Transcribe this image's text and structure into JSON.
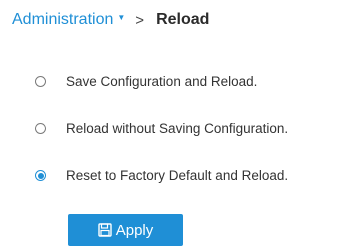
{
  "breadcrumb": {
    "parent": "Administration",
    "caret_icon": "caret-down-icon",
    "separator": ">",
    "current": "Reload"
  },
  "options": [
    {
      "label": "Save Configuration and Reload.",
      "selected": false
    },
    {
      "label": "Reload without Saving Configuration.",
      "selected": false
    },
    {
      "label": "Reset to Factory Default and Reload.",
      "selected": true
    }
  ],
  "apply_button": {
    "icon": "save-icon",
    "label": "Apply"
  },
  "colors": {
    "accent": "#1f8fd6",
    "text": "#333333"
  }
}
